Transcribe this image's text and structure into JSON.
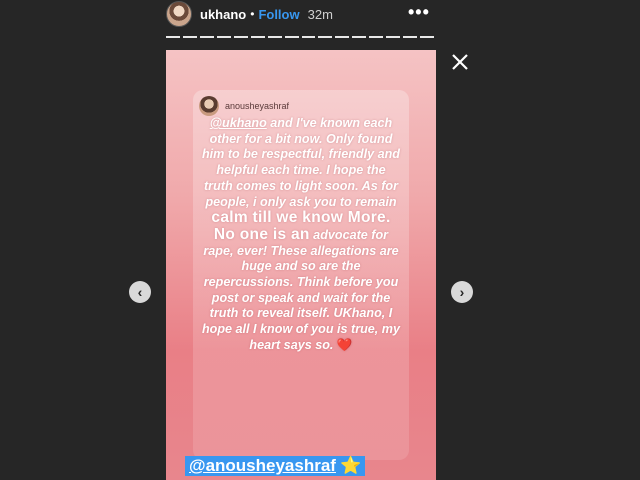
{
  "header": {
    "username": "ukhano",
    "separator": "•",
    "follow_label": "Follow",
    "time": "32m",
    "more_icon": "•••"
  },
  "progress_segments": 16,
  "story": {
    "card_username": "anousheyashraf",
    "mention": "@ukhano",
    "text_1": " and I've known each other for a bit now. Only found him to be respectful, friendly and helpful each time. I hope the truth comes to light soon. As for people, i only ask you to remain ",
    "text_big": "calm till we know More. No one is an",
    "text_2": " advocate for rape, ever! These allegations are huge and so are the repercussions. Think before you post or speak and wait for the truth to reveal itself. UKhano, I hope all I know of you is true, my heart says so. ",
    "heart": "❤️",
    "tag": "@anousheyashraf",
    "tag_star": "⭐"
  },
  "nav": {
    "prev": "‹",
    "next": "›"
  },
  "colors": {
    "background": "#262626",
    "follow": "#3897f0",
    "tag_bg": "#3897f0"
  }
}
